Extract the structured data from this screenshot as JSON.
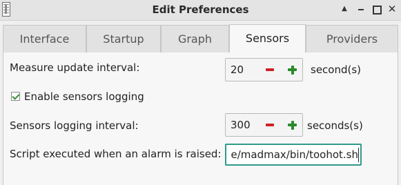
{
  "window": {
    "title": "Edit Preferences",
    "app_icon": "thermometer-icon",
    "controls": [
      "shade-up-icon",
      "minimize-icon",
      "maximize-icon",
      "close-icon"
    ]
  },
  "tabs": [
    {
      "label": "Interface",
      "active": false
    },
    {
      "label": "Startup",
      "active": false
    },
    {
      "label": "Graph",
      "active": false
    },
    {
      "label": "Sensors",
      "active": true
    },
    {
      "label": "Providers",
      "active": false
    }
  ],
  "sensors": {
    "update_interval": {
      "label": "Measure update interval:",
      "value": "20",
      "unit": "second(s)"
    },
    "logging": {
      "label": "Enable sensors logging",
      "checked": true
    },
    "logging_interval": {
      "label": "Sensors logging interval:",
      "value": "300",
      "unit": "seconds(s)"
    },
    "alarm_script": {
      "label": "Script executed when an alarm is raised:",
      "value": "e/madmax/bin/toohot.sh"
    }
  },
  "colors": {
    "minus": "#cc2222",
    "plus": "#2a8a2a",
    "focus_border": "#2f9a8a",
    "check": "#3a8f3a"
  }
}
